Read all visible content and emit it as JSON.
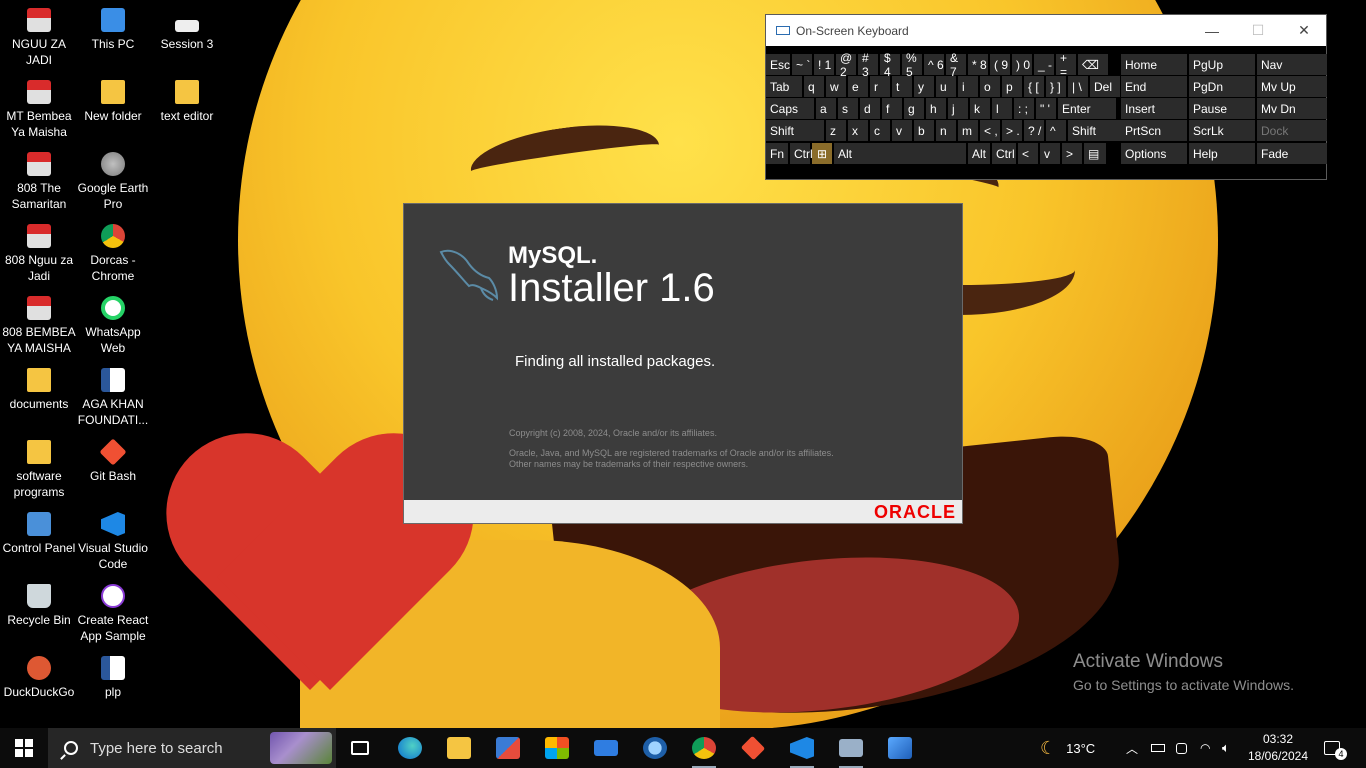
{
  "desktop": {
    "icons": [
      {
        "label": "NGUU ZA JADI",
        "icon": "pdf-icon"
      },
      {
        "label": "This PC",
        "icon": "computer-icon"
      },
      {
        "label": "Session 3",
        "icon": "file-icon"
      },
      {
        "label": "MT Bembea Ya Maisha",
        "icon": "pdf-icon"
      },
      {
        "label": "New folder",
        "icon": "folder-icon"
      },
      {
        "label": "text editor",
        "icon": "folder-icon"
      },
      {
        "label": "808 The Samaritan",
        "icon": "pdf-icon"
      },
      {
        "label": "Google Earth Pro",
        "icon": "google-earth-icon"
      },
      {
        "label": "808 Nguu za Jadi",
        "icon": "pdf-icon"
      },
      {
        "label": "Dorcas - Chrome",
        "icon": "chrome-icon"
      },
      {
        "label": "808 BEMBEA YA MAISHA",
        "icon": "pdf-icon"
      },
      {
        "label": "WhatsApp Web",
        "icon": "whatsapp-icon"
      },
      {
        "label": "documents",
        "icon": "folder-icon"
      },
      {
        "label": "AGA KHAN FOUNDATI...",
        "icon": "word-icon"
      },
      {
        "label": "software programs",
        "icon": "folder-icon"
      },
      {
        "label": "Git Bash",
        "icon": "git-icon"
      },
      {
        "label": "Control Panel",
        "icon": "control-panel-icon"
      },
      {
        "label": "Visual Studio Code",
        "icon": "vscode-icon"
      },
      {
        "label": "Recycle Bin",
        "icon": "recycle-bin-icon"
      },
      {
        "label": "Create React App Sample",
        "icon": "react-icon"
      },
      {
        "label": "DuckDuckGo",
        "icon": "duckduckgo-icon"
      },
      {
        "label": "plp",
        "icon": "word-icon"
      }
    ]
  },
  "osk": {
    "title": "On-Screen Keyboard",
    "window_controls": {
      "minimize": "—",
      "maximize": "☐",
      "close": "✕"
    },
    "rows": {
      "r1": [
        "Esc",
        "~ `",
        "! 1",
        "@ 2",
        "# 3",
        "$ 4",
        "% 5",
        "^ 6",
        "& 7",
        "* 8",
        "( 9",
        ") 0",
        "_ -",
        "+ =",
        "⌫"
      ],
      "r2": [
        "Tab",
        "q",
        "w",
        "e",
        "r",
        "t",
        "y",
        "u",
        "i",
        "o",
        "p",
        "{ [",
        "} ]",
        "| \\",
        "Del"
      ],
      "r3": [
        "Caps",
        "a",
        "s",
        "d",
        "f",
        "g",
        "h",
        "j",
        "k",
        "l",
        ": ;",
        "\" '",
        "Enter"
      ],
      "r4": [
        "Shift",
        "z",
        "x",
        "c",
        "v",
        "b",
        "n",
        "m",
        "< ,",
        "> .",
        "? /",
        "^",
        "Shift"
      ],
      "r5": [
        "Fn",
        "Ctrl",
        "⊞",
        "Alt",
        "Alt",
        "Ctrl",
        "<",
        "v",
        ">",
        "▤"
      ]
    },
    "nav_keys": [
      [
        "Home",
        "PgUp",
        "Nav"
      ],
      [
        "End",
        "PgDn",
        "Mv Up"
      ],
      [
        "Insert",
        "Pause",
        "Mv Dn"
      ],
      [
        "PrtScn",
        "ScrLk",
        "Dock"
      ],
      [
        "Options",
        "Help",
        "Fade"
      ]
    ]
  },
  "installer": {
    "brand": "MySQL.",
    "product": "Installer 1.6",
    "status": "Finding all installed packages.",
    "copyright": "Copyright (c) 2008, 2024, Oracle and/or its affiliates.",
    "trademark1": "Oracle, Java, and MySQL are registered trademarks of Oracle and/or its affiliates.",
    "trademark2": "Other names may be trademarks of their respective owners.",
    "vendor": "ORACLE"
  },
  "watermark": {
    "line1": "Activate Windows",
    "line2": "Go to Settings to activate Windows."
  },
  "taskbar": {
    "search_placeholder": "Type here to search",
    "apps": [
      "task-view",
      "edge",
      "file-explorer",
      "git-tools",
      "microsoft-store",
      "mail",
      "search-tool",
      "chrome",
      "git",
      "vscode",
      "remote-desktop",
      "photos"
    ],
    "weather": "13°C",
    "time": "03:32",
    "date": "18/06/2024",
    "notifications": "4"
  }
}
